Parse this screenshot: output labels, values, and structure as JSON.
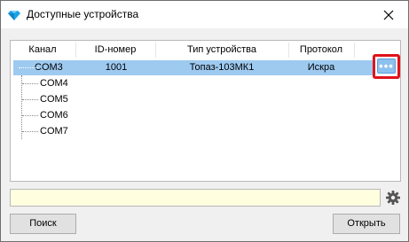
{
  "window": {
    "title": "Доступные устройства",
    "icon": "gem-icon",
    "close_icon": "close-icon"
  },
  "table": {
    "headers": [
      "Канал",
      "ID-номер",
      "Тип устройства",
      "Протокол"
    ],
    "rows": [
      {
        "channel": "COM3",
        "id": "1001",
        "device_type": "Топаз-103МК1",
        "protocol": "Искра",
        "selected": true
      },
      {
        "channel": "COM4"
      },
      {
        "channel": "COM5"
      },
      {
        "channel": "COM6"
      },
      {
        "channel": "COM7"
      }
    ],
    "ellipsis_label": "•••",
    "selection_color": "#9ecaf0"
  },
  "status": {
    "text": "",
    "background": "#ffffe0",
    "gear_icon": "gear-icon"
  },
  "buttons": {
    "search": "Поиск",
    "open": "Открыть"
  },
  "colors": {
    "highlight": "#e0131a",
    "accent": "#1aa3e8"
  }
}
